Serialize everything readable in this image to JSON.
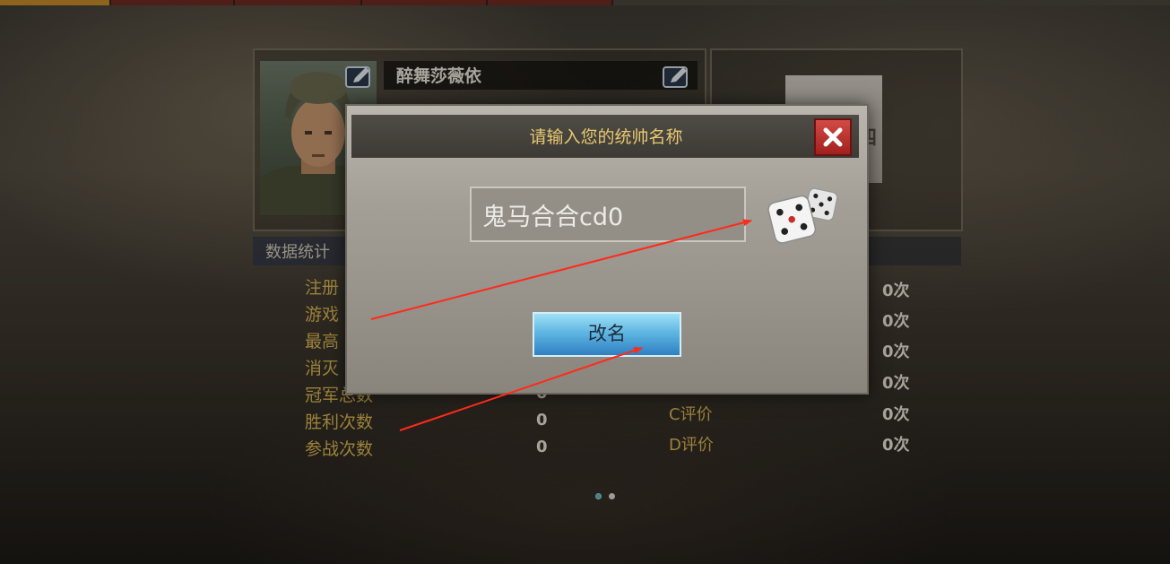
{
  "player": {
    "name": "醉舞莎薇依"
  },
  "stats": {
    "title": "数据统计",
    "left_rows": [
      {
        "label": "注册",
        "value": ""
      },
      {
        "label": "游戏",
        "value": ""
      },
      {
        "label": "最高",
        "value": ""
      },
      {
        "label": "消灭",
        "value": ""
      },
      {
        "label": "冠军总数",
        "value": "0"
      },
      {
        "label": "胜利次数",
        "value": "0"
      },
      {
        "label": "参战次数",
        "value": "0"
      }
    ],
    "right_rows": [
      {
        "label": "",
        "value": "0次"
      },
      {
        "label": "",
        "value": "0次"
      },
      {
        "label": "",
        "value": "0次"
      },
      {
        "label": "",
        "value": "0次"
      },
      {
        "label": "C评价",
        "value": "0次"
      },
      {
        "label": "D评价",
        "value": "0次"
      }
    ]
  },
  "rank_card": {
    "glyph": "四"
  },
  "dialog": {
    "title": "请输入您的统帅名称",
    "input_value": "鬼马合合cd0",
    "rename_label": "改名",
    "close_glyph": "✕"
  },
  "pagination": {
    "count": 2,
    "active_index": 0
  },
  "colors": {
    "label_gold": "#d8b452",
    "dialog_title": "#e8c870",
    "close_red": "#c4302c",
    "button_blue": "#5fb6e2",
    "annotation_red": "#ff2a1a",
    "dot_active": "#5fb0c0",
    "dot_inactive": "#d8d8d8"
  },
  "icons": [
    "edit-icon",
    "close-icon",
    "dice-icon"
  ]
}
